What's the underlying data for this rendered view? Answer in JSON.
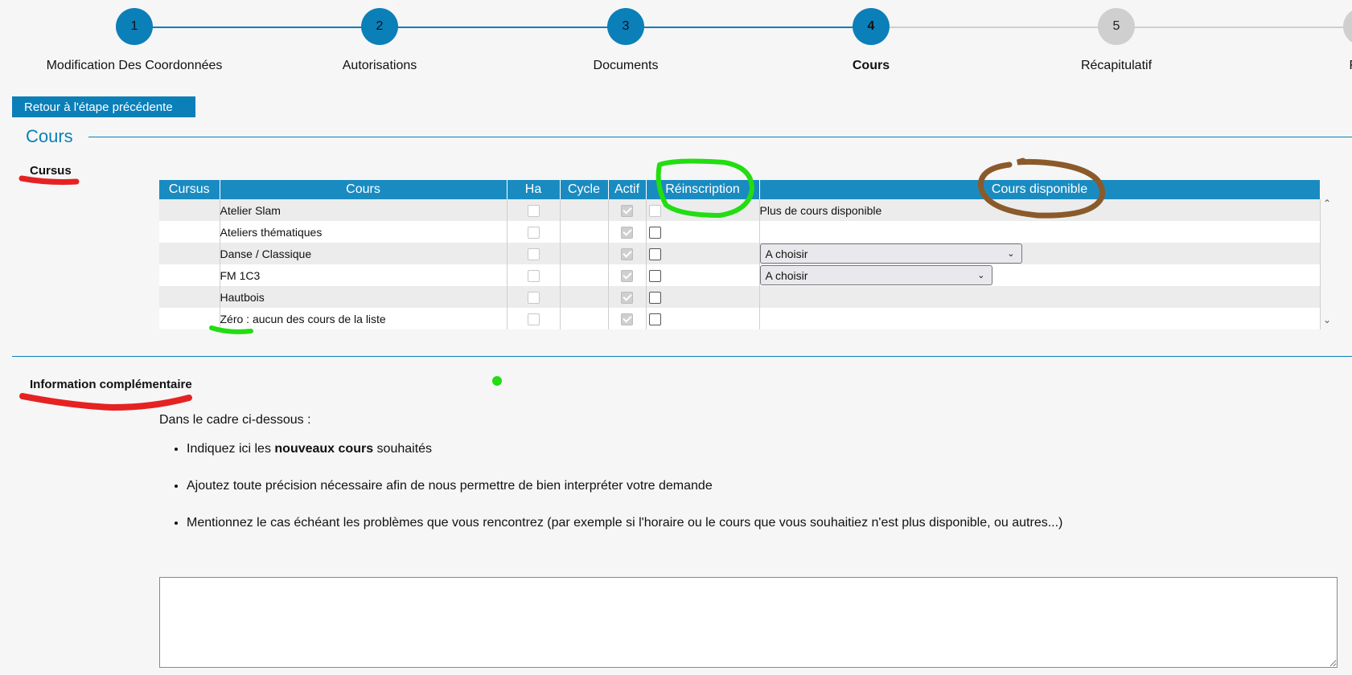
{
  "stepper": {
    "steps": [
      {
        "number": "1",
        "label": "Modification Des Coordonnées",
        "state": "done"
      },
      {
        "number": "2",
        "label": "Autorisations",
        "state": "done"
      },
      {
        "number": "3",
        "label": "Documents",
        "state": "done"
      },
      {
        "number": "4",
        "label": "Cours",
        "state": "current"
      },
      {
        "number": "5",
        "label": "Récapitulatif",
        "state": "todo"
      },
      {
        "number": "",
        "label": "Fina",
        "state": "todo"
      }
    ]
  },
  "back_button": "Retour à l'étape précédente",
  "section_title": "Cours",
  "cursus_label": "Cursus",
  "table": {
    "headers": [
      "Cursus",
      "Cours",
      "Ha",
      "Cycle",
      "Actif",
      "Réinscription",
      "Cours disponible"
    ],
    "rows": [
      {
        "cursus": "",
        "cours": "Atelier Slam",
        "ha": false,
        "cycle": "",
        "actif": true,
        "reinscription": false,
        "disponible_text": "Plus de cours disponible",
        "disponible_select": ""
      },
      {
        "cursus": "",
        "cours": "Ateliers thématiques",
        "ha": false,
        "cycle": "",
        "actif": true,
        "reinscription": false,
        "disponible_text": "",
        "disponible_select": ""
      },
      {
        "cursus": "",
        "cours": "Danse / Classique",
        "ha": false,
        "cycle": "",
        "actif": true,
        "reinscription": false,
        "disponible_text": "",
        "disponible_select": "A choisir"
      },
      {
        "cursus": "",
        "cours": "FM 1C3",
        "ha": false,
        "cycle": "",
        "actif": true,
        "reinscription": false,
        "disponible_text": "",
        "disponible_select": "A choisir"
      },
      {
        "cursus": "",
        "cours": "Hautbois",
        "ha": false,
        "cycle": "",
        "actif": true,
        "reinscription": false,
        "disponible_text": "",
        "disponible_select": ""
      },
      {
        "cursus": "",
        "cours": "Zéro : aucun des cours de la liste",
        "ha": false,
        "cycle": "",
        "actif": true,
        "reinscription": false,
        "disponible_text": "",
        "disponible_select": ""
      }
    ]
  },
  "info": {
    "title": "Information complémentaire",
    "intro": "Dans le cadre ci-dessous :",
    "bullet1_pre": "Indiquez ici les ",
    "bullet1_bold": "nouveaux cours",
    "bullet1_post": " souhaités",
    "bullet2": "Ajoutez toute précision nécessaire afin de nous permettre de bien interpréter votre demande",
    "bullet3": "Mentionnez le cas échéant les problèmes que vous rencontrez (par exemple si l'horaire ou le cours que vous souhaitiez n'est plus disponible, ou autres...)",
    "textarea_value": ""
  },
  "colors": {
    "accent": "#0b7fb8",
    "header_bg": "#1a8bc1",
    "todo_circle": "#cfcfcf",
    "annotation_red": "#e52222",
    "annotation_green": "#22dd11",
    "annotation_brown": "#8b5a2b"
  }
}
